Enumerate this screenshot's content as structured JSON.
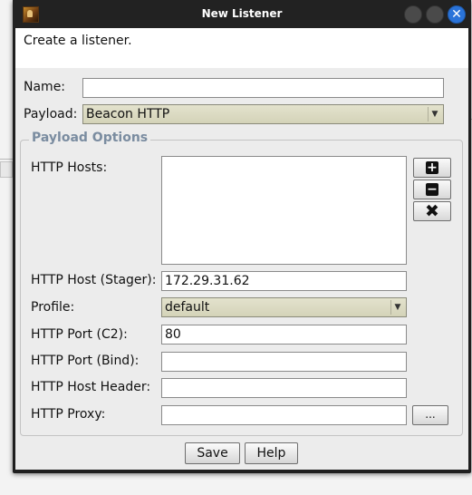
{
  "window": {
    "title": "New Listener",
    "app_icon": "cobalt-strike-app-icon",
    "controls": [
      "minimize-icon",
      "maximize-icon",
      "close-icon"
    ]
  },
  "description": "Create a listener.",
  "form": {
    "name_label": "Name:",
    "name_value": "",
    "payload_label": "Payload:",
    "payload_value": "Beacon HTTP"
  },
  "payload_options": {
    "title": "Payload Options",
    "http_hosts_label": "HTTP Hosts:",
    "http_hosts": [],
    "host_stager_label": "HTTP Host (Stager):",
    "host_stager_value": "172.29.31.62",
    "profile_label": "Profile:",
    "profile_value": "default",
    "port_c2_label": "HTTP Port (C2):",
    "port_c2_value": "80",
    "port_bind_label": "HTTP Port (Bind):",
    "port_bind_value": "",
    "host_header_label": "HTTP Host Header:",
    "host_header_value": "",
    "proxy_label": "HTTP Proxy:",
    "proxy_value": "",
    "proxy_button_label": "...",
    "host_buttons": [
      "add-icon",
      "remove-icon",
      "clear-icon"
    ]
  },
  "buttons": {
    "save": "Save",
    "help": "Help"
  },
  "colors": {
    "titlebar": "#222222",
    "close_button": "#2a73d9",
    "select_bg": "#dcdbc2",
    "group_title": "#7a8ca0"
  }
}
